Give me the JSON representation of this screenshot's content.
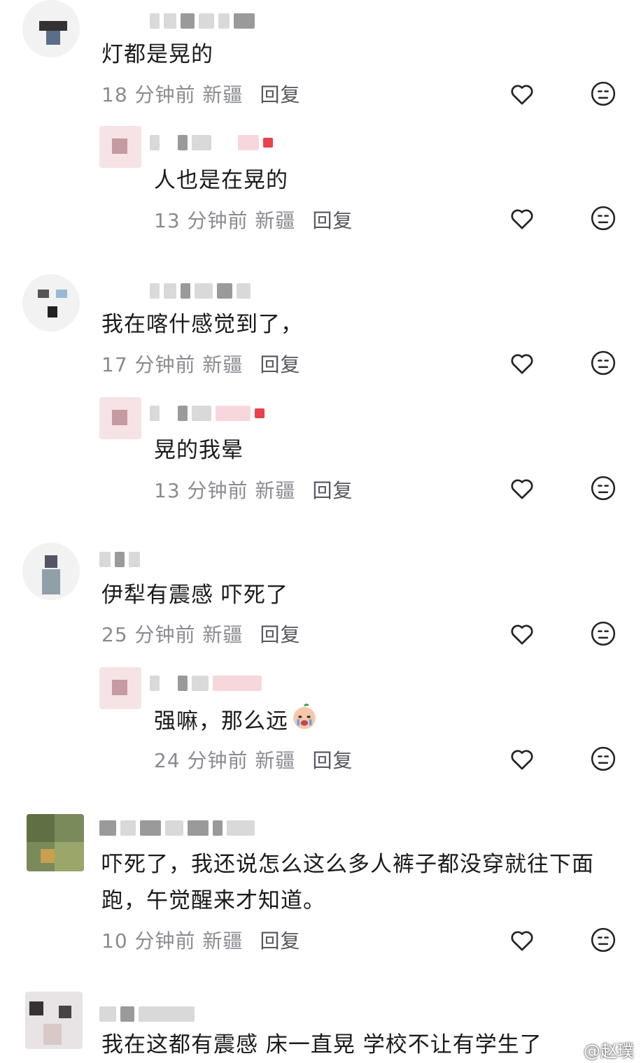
{
  "comments": [
    {
      "text": "灯都是晃的",
      "meta": "18 分钟前  新疆",
      "reply": "回复",
      "replies": [
        {
          "text": "人也是在晃的",
          "meta": "13 分钟前  新疆",
          "reply": "回复"
        }
      ]
    },
    {
      "text": "我在喀什感觉到了，",
      "meta": "17 分钟前  新疆",
      "reply": "回复",
      "replies": [
        {
          "text": "晃的我晕",
          "meta": "13 分钟前  新疆",
          "reply": "回复"
        }
      ]
    },
    {
      "text": "伊犁有震感 吓死了",
      "meta": "25 分钟前  新疆",
      "reply": "回复",
      "replies": [
        {
          "text": "强嘛，那么远",
          "meta": "24 分钟前  新疆",
          "reply": "回复",
          "emoji": "crying-face-icon"
        }
      ]
    },
    {
      "text_line1": "吓死了，我还说怎么这么多人裤子都没穿就往下面",
      "text_line2": "跑，午觉醒来才知道。",
      "meta": "10 分钟前  新疆",
      "reply": "回复"
    },
    {
      "text": "我在这都有震感 床一直晃 学校不让有学生了"
    }
  ],
  "watermark": "@赵璞",
  "icons": {
    "like": "heart-outline-icon",
    "dislike": "meh-face-icon",
    "watermark": "weibo-logo-icon"
  },
  "colors": {
    "text": "#1a1a1a",
    "meta": "#8a8b91",
    "reply": "#55565c"
  }
}
